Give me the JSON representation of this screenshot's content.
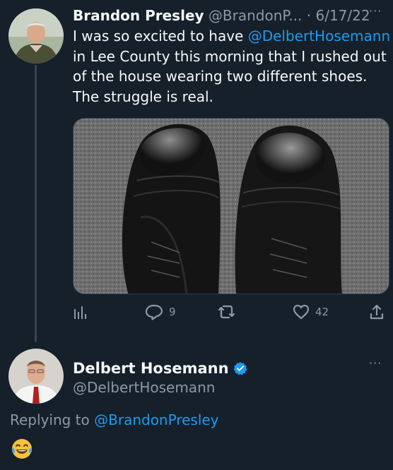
{
  "tweet": {
    "author_name": "Brandon Presley",
    "author_handle": "@BrandonP...",
    "separator": "·",
    "date": "6/17/22",
    "more_label": "···",
    "text_before": "I was so excited to have ",
    "mention": "@DelbertHosemann",
    "text_after": " in Lee County this morning that I rushed out of the house wearing two different shoes. The struggle is real.",
    "photo_icon": "shoes-photo",
    "actions": {
      "stats_icon": "analytics-icon",
      "reply_icon": "reply-icon",
      "reply_count": "9",
      "retweet_icon": "retweet-icon",
      "like_icon": "heart-icon",
      "like_count": "42",
      "share_icon": "share-icon"
    }
  },
  "reply": {
    "author_name": "Delbert Hosemann",
    "verified_icon": "verified-badge-icon",
    "author_handle": "@DelbertHosemann",
    "more_label": "···",
    "replying_prefix": "Replying to ",
    "replying_to": "@BrandonPresley",
    "emoji_icon": "face-with-tears-of-joy-icon"
  },
  "colors": {
    "background": "#15202b",
    "text": "#f7f9f9",
    "muted": "#8b98a5",
    "link": "#1d9bf0",
    "thread_line": "#38444d"
  }
}
